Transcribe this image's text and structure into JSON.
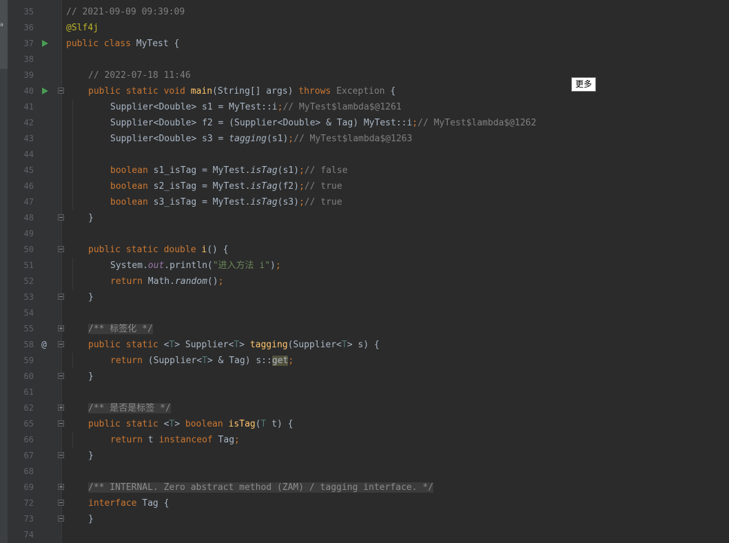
{
  "tooltip": {
    "text": "更多"
  },
  "left_strip_mark": "a",
  "colors": {
    "background": "#2b2b2b",
    "gutter": "#313335",
    "keyword": "#cc7832",
    "annotation": "#bbb529",
    "comment": "#808080",
    "method_decl": "#ffc66d",
    "string": "#6a8759",
    "field": "#9876aa",
    "type_param": "#507874",
    "text": "#a9b7c6"
  },
  "lines": [
    {
      "num": "35",
      "indent": 0,
      "tokens": [
        {
          "t": "// 2021-09-09 09:39:09",
          "c": "cmt"
        }
      ]
    },
    {
      "num": "36",
      "indent": 0,
      "tokens": [
        {
          "t": "@Slf4j",
          "c": "ann"
        }
      ]
    },
    {
      "num": "37",
      "indent": 0,
      "icon": "run-icon",
      "tokens": [
        {
          "t": "public class ",
          "c": "kw"
        },
        {
          "t": "MyTest {",
          "c": "plain"
        }
      ]
    },
    {
      "num": "38",
      "indent": 0,
      "tokens": []
    },
    {
      "num": "39",
      "indent": 1,
      "tokens": [
        {
          "t": "// 2022-07-18 11:46",
          "c": "cmt"
        }
      ]
    },
    {
      "num": "40",
      "indent": 1,
      "icon": "run-icon",
      "fold": "open",
      "tokens": [
        {
          "t": "public static void ",
          "c": "kw"
        },
        {
          "t": "main",
          "c": "fn"
        },
        {
          "t": "(String[] args) ",
          "c": "plain"
        },
        {
          "t": "throws ",
          "c": "kw"
        },
        {
          "t": "Exception",
          "c": "cmt"
        },
        {
          "t": " {",
          "c": "plain"
        }
      ]
    },
    {
      "num": "41",
      "indent": 2,
      "tokens": [
        {
          "t": "Supplier<Double> s1 = MyTest::i",
          "c": "plain"
        },
        {
          "t": ";",
          "c": "kw"
        },
        {
          "t": "// MyTest$lambda$@1261",
          "c": "cmt"
        }
      ]
    },
    {
      "num": "42",
      "indent": 2,
      "tokens": [
        {
          "t": "Supplier<Double> f2 = (Supplier<Double> & Tag) MyTest::i",
          "c": "plain"
        },
        {
          "t": ";",
          "c": "kw"
        },
        {
          "t": "// MyTest$lambda$@1262",
          "c": "cmt"
        }
      ]
    },
    {
      "num": "43",
      "indent": 2,
      "tokens": [
        {
          "t": "Supplier<Double> s3 = ",
          "c": "plain"
        },
        {
          "t": "tagging",
          "c": "static"
        },
        {
          "t": "(s1)",
          "c": "plain"
        },
        {
          "t": ";",
          "c": "kw"
        },
        {
          "t": "// MyTest$lambda$@1263",
          "c": "cmt"
        }
      ]
    },
    {
      "num": "44",
      "indent": 2,
      "tokens": []
    },
    {
      "num": "45",
      "indent": 2,
      "tokens": [
        {
          "t": "boolean ",
          "c": "kw"
        },
        {
          "t": "s1_isTag = MyTest.",
          "c": "plain"
        },
        {
          "t": "isTag",
          "c": "static"
        },
        {
          "t": "(s1)",
          "c": "plain"
        },
        {
          "t": ";",
          "c": "kw"
        },
        {
          "t": "// false",
          "c": "cmt"
        }
      ]
    },
    {
      "num": "46",
      "indent": 2,
      "tokens": [
        {
          "t": "boolean ",
          "c": "kw"
        },
        {
          "t": "s2_isTag = MyTest.",
          "c": "plain"
        },
        {
          "t": "isTag",
          "c": "static"
        },
        {
          "t": "(f2)",
          "c": "plain"
        },
        {
          "t": ";",
          "c": "kw"
        },
        {
          "t": "// true",
          "c": "cmt"
        }
      ]
    },
    {
      "num": "47",
      "indent": 2,
      "tokens": [
        {
          "t": "boolean ",
          "c": "kw"
        },
        {
          "t": "s3_isTag = MyTest.",
          "c": "plain"
        },
        {
          "t": "isTag",
          "c": "static"
        },
        {
          "t": "(s3)",
          "c": "plain"
        },
        {
          "t": ";",
          "c": "kw"
        },
        {
          "t": "// true",
          "c": "cmt"
        }
      ]
    },
    {
      "num": "48",
      "indent": 1,
      "fold": "close",
      "tokens": [
        {
          "t": "}",
          "c": "plain"
        }
      ]
    },
    {
      "num": "49",
      "indent": 1,
      "tokens": []
    },
    {
      "num": "50",
      "indent": 1,
      "fold": "open",
      "tokens": [
        {
          "t": "public static double ",
          "c": "kw"
        },
        {
          "t": "i",
          "c": "fn"
        },
        {
          "t": "() {",
          "c": "plain"
        }
      ]
    },
    {
      "num": "51",
      "indent": 2,
      "tokens": [
        {
          "t": "System.",
          "c": "plain"
        },
        {
          "t": "out",
          "c": "field"
        },
        {
          "t": ".println(",
          "c": "plain"
        },
        {
          "t": "\"进入方法 i\"",
          "c": "str"
        },
        {
          "t": ")",
          "c": "plain"
        },
        {
          "t": ";",
          "c": "kw"
        }
      ]
    },
    {
      "num": "52",
      "indent": 2,
      "tokens": [
        {
          "t": "return ",
          "c": "kw"
        },
        {
          "t": "Math.",
          "c": "plain"
        },
        {
          "t": "random",
          "c": "static"
        },
        {
          "t": "()",
          "c": "plain"
        },
        {
          "t": ";",
          "c": "kw"
        }
      ]
    },
    {
      "num": "53",
      "indent": 1,
      "fold": "close",
      "tokens": [
        {
          "t": "}",
          "c": "plain"
        }
      ]
    },
    {
      "num": "54",
      "indent": 1,
      "tokens": []
    },
    {
      "num": "55",
      "indent": 1,
      "fold": "plus",
      "tokens": [
        {
          "t": "/** 标签化 */",
          "c": "fold"
        }
      ]
    },
    {
      "num": "58",
      "indent": 1,
      "icon": "at-icon",
      "fold": "open",
      "tokens": [
        {
          "t": "public static ",
          "c": "kw"
        },
        {
          "t": "<",
          "c": "plain"
        },
        {
          "t": "T",
          "c": "tp"
        },
        {
          "t": "> Supplier<",
          "c": "plain"
        },
        {
          "t": "T",
          "c": "tp"
        },
        {
          "t": "> ",
          "c": "plain"
        },
        {
          "t": "tagging",
          "c": "fn"
        },
        {
          "t": "(Supplier<",
          "c": "plain"
        },
        {
          "t": "T",
          "c": "tp"
        },
        {
          "t": "> s) {",
          "c": "plain"
        }
      ]
    },
    {
      "num": "59",
      "indent": 2,
      "tokens": [
        {
          "t": "return ",
          "c": "kw"
        },
        {
          "t": "(Supplier<",
          "c": "plain"
        },
        {
          "t": "T",
          "c": "tp"
        },
        {
          "t": "> & Tag) s::",
          "c": "plain"
        },
        {
          "t": "get",
          "c": "hl"
        },
        {
          "t": ";",
          "c": "kw"
        }
      ]
    },
    {
      "num": "60",
      "indent": 1,
      "fold": "close",
      "tokens": [
        {
          "t": "}",
          "c": "plain"
        }
      ]
    },
    {
      "num": "61",
      "indent": 1,
      "tokens": []
    },
    {
      "num": "62",
      "indent": 1,
      "fold": "plus",
      "tokens": [
        {
          "t": "/** 是否是标签 */",
          "c": "fold"
        }
      ]
    },
    {
      "num": "65",
      "indent": 1,
      "fold": "open",
      "tokens": [
        {
          "t": "public static ",
          "c": "kw"
        },
        {
          "t": "<",
          "c": "plain"
        },
        {
          "t": "T",
          "c": "tp"
        },
        {
          "t": "> ",
          "c": "plain"
        },
        {
          "t": "boolean ",
          "c": "kw"
        },
        {
          "t": "isTag",
          "c": "fn"
        },
        {
          "t": "(",
          "c": "plain"
        },
        {
          "t": "T",
          "c": "tp"
        },
        {
          "t": " t) {",
          "c": "plain"
        }
      ]
    },
    {
      "num": "66",
      "indent": 2,
      "tokens": [
        {
          "t": "return ",
          "c": "kw"
        },
        {
          "t": "t ",
          "c": "plain"
        },
        {
          "t": "instanceof ",
          "c": "kw"
        },
        {
          "t": "Tag",
          "c": "plain"
        },
        {
          "t": ";",
          "c": "kw"
        }
      ]
    },
    {
      "num": "67",
      "indent": 1,
      "fold": "close",
      "tokens": [
        {
          "t": "}",
          "c": "plain"
        }
      ]
    },
    {
      "num": "68",
      "indent": 1,
      "tokens": []
    },
    {
      "num": "69",
      "indent": 1,
      "fold": "plus",
      "tokens": [
        {
          "t": "/** INTERNAL. Zero abstract method (ZAM) / tagging interface. */",
          "c": "fold"
        }
      ]
    },
    {
      "num": "72",
      "indent": 1,
      "fold": "open",
      "tokens": [
        {
          "t": "interface ",
          "c": "kw"
        },
        {
          "t": "Tag {",
          "c": "plain"
        }
      ]
    },
    {
      "num": "73",
      "indent": 1,
      "fold": "close",
      "tokens": [
        {
          "t": "}",
          "c": "plain"
        }
      ]
    },
    {
      "num": "74",
      "indent": 0,
      "tokens": []
    }
  ]
}
